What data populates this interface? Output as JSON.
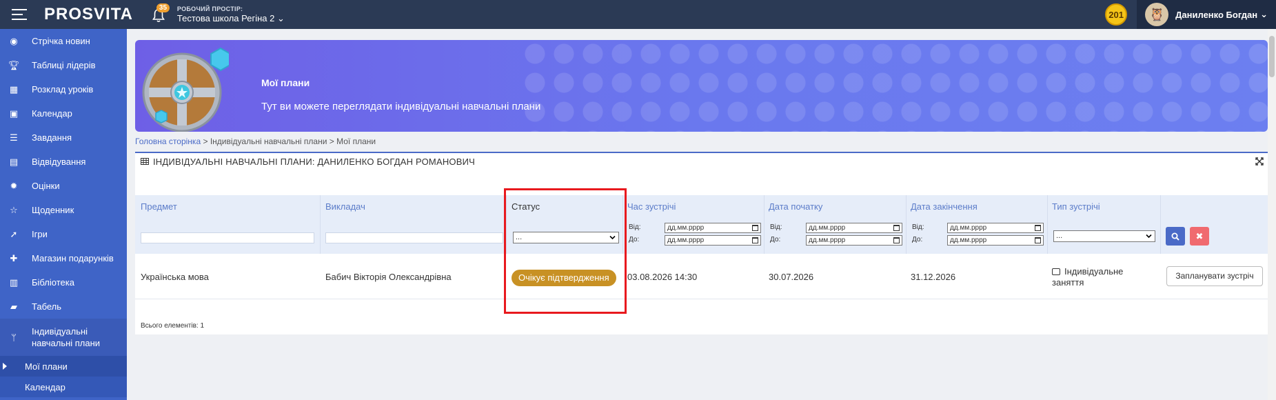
{
  "topbar": {
    "logo": "PROSVITA",
    "notifications_count": "35",
    "workspace_label": "РОБОЧИЙ ПРОСТІР:",
    "workspace_value": "Тестова школа Регіна 2",
    "coins": "201",
    "user_name": "Даниленко Богдан"
  },
  "sidebar": {
    "items": [
      {
        "label": "Стрічка новин",
        "icon": "rss-icon"
      },
      {
        "label": "Таблиці лідерів",
        "icon": "trophy-icon"
      },
      {
        "label": "Розклад уроків",
        "icon": "calendar-grid-icon"
      },
      {
        "label": "Календар",
        "icon": "calendar-icon"
      },
      {
        "label": "Завдання",
        "icon": "tasks-icon"
      },
      {
        "label": "Відвідування",
        "icon": "document-icon"
      },
      {
        "label": "Оцінки",
        "icon": "gear-badge-icon"
      },
      {
        "label": "Щоденник",
        "icon": "star-icon"
      },
      {
        "label": "Ігри",
        "icon": "rocket-icon"
      },
      {
        "label": "Магазин подарунків",
        "icon": "gift-icon"
      },
      {
        "label": "Бібліотека",
        "icon": "book-icon"
      },
      {
        "label": "Табель",
        "icon": "folder-icon"
      }
    ],
    "expanded": {
      "label_line1": "Індивідуальні",
      "label_line2": "навчальні плани"
    },
    "sub_items": [
      {
        "label": "Мої плани"
      },
      {
        "label": "Календар"
      }
    ]
  },
  "banner": {
    "title": "Мої плани",
    "subtitle": "Тут ви можете переглядати індивідуальні навчальні плани"
  },
  "breadcrumb": {
    "home": "Головна сторінка",
    "sep": ">",
    "level2": "Індивідуальні навчальні плани",
    "level3": "Мої плани"
  },
  "panel": {
    "title": "ІНДИВІДУАЛЬНІ НАВЧАЛЬНІ ПЛАНИ: ДАНИЛЕНКО БОГДАН РОМАНОВИЧ"
  },
  "table": {
    "columns": [
      "Предмет",
      "Викладач",
      "Статус",
      "Час зустрічі",
      "Дата початку",
      "Дата закінчення",
      "Тип зустрічі"
    ],
    "filters": {
      "status_select": "...",
      "meet_type_select": "...",
      "from_label": "Від:",
      "to_label": "До:",
      "date_placeholder": "дд.мм.рррр"
    },
    "rows": [
      {
        "subject": "Українська мова",
        "teacher": "Бабич Вікторія Олександрівна",
        "status": "Очікує підтвердження",
        "meeting_time": "03.08.2026 14:30",
        "start_date": "30.07.2026",
        "end_date": "31.12.2026",
        "meeting_type": "Індивідуальне заняття",
        "action": "Запланувати зустріч"
      }
    ],
    "total": "Всього елементів: 1"
  },
  "colors": {
    "topbar": "#2b3a55",
    "sidebar": "#3f64c7",
    "accent": "#4a6ac7",
    "status_badge": "#c89124",
    "highlight": "#e8191e"
  }
}
